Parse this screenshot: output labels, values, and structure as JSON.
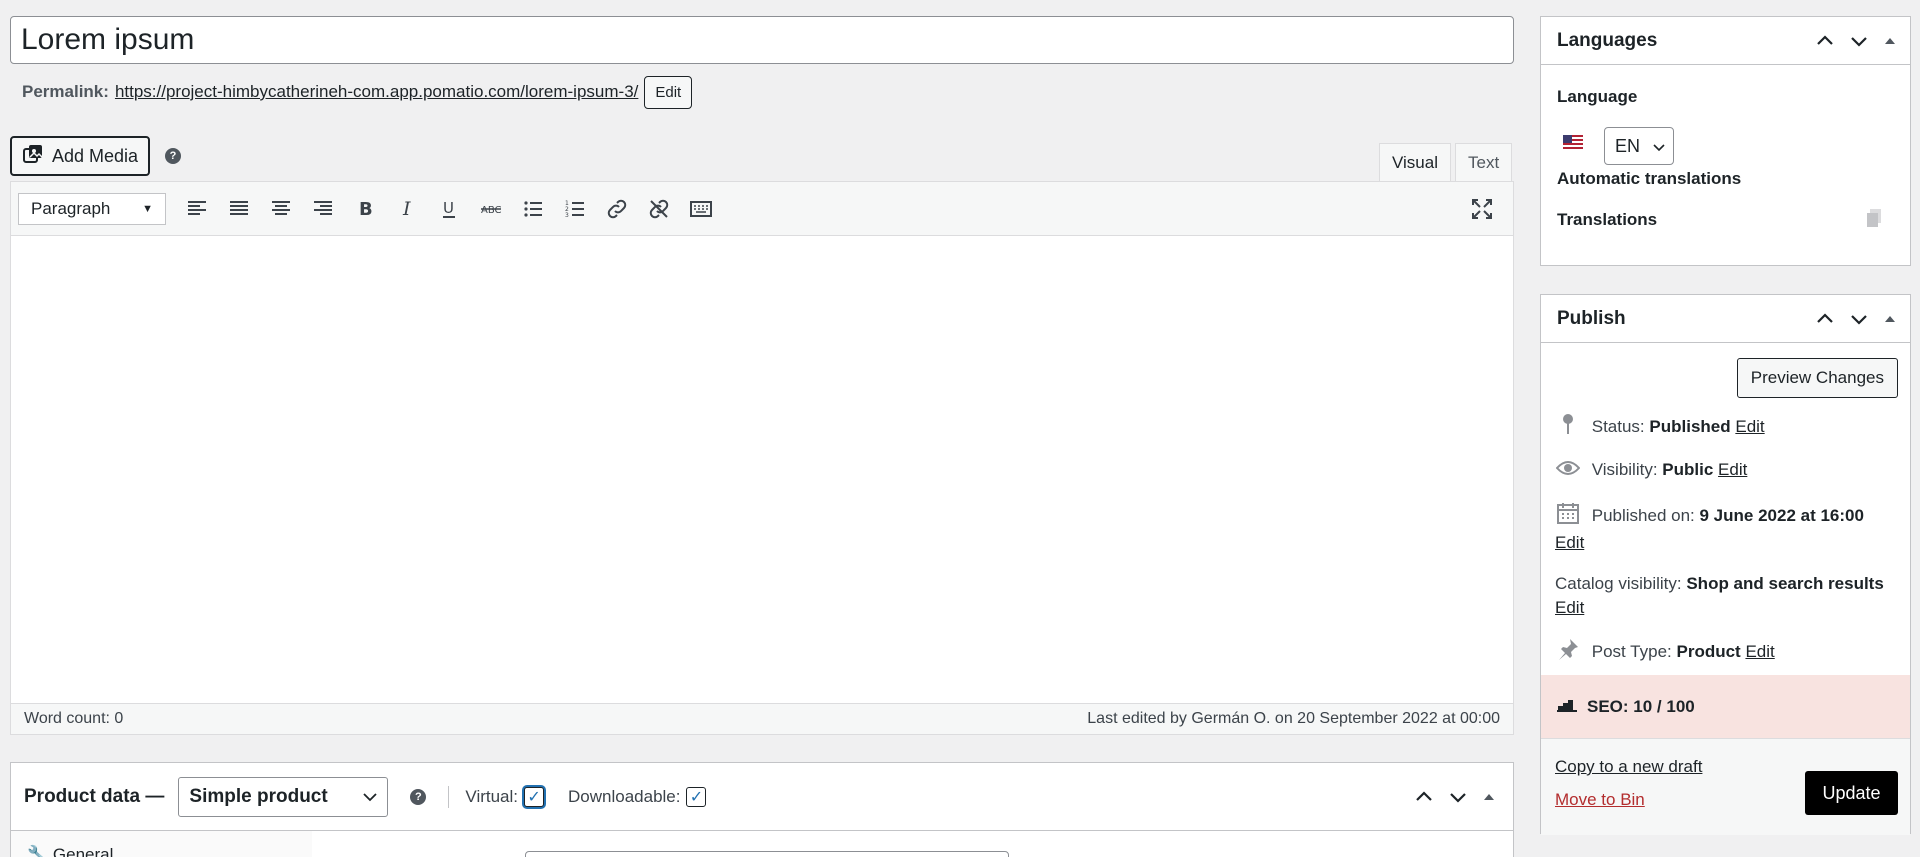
{
  "post": {
    "title": "Lorem ipsum",
    "permalink_label": "Permalink:",
    "permalink_url": "https://project-himbycatherineh-com.app.pomatio.com/lorem-ipsum-3/",
    "permalink_edit": "Edit"
  },
  "media": {
    "add_label": "Add Media",
    "help": "?"
  },
  "editor": {
    "tabs": [
      "Visual",
      "Text"
    ],
    "active_tab": "Visual",
    "format": "Paragraph",
    "word_count": "Word count: 0",
    "last_edited": "Last edited by Germán O. on 20 September 2022 at 00:00",
    "toolbar_icons": [
      "align-left-icon",
      "align-justify-icon",
      "align-center-icon",
      "align-right-icon",
      "bold-icon",
      "italic-icon",
      "underline-icon",
      "strikethrough-icon",
      "bullet-list-icon",
      "numbered-list-icon",
      "link-icon",
      "unlink-icon",
      "keyboard-icon",
      "fullscreen-icon"
    ]
  },
  "product_data": {
    "title": "Product data —",
    "type": "Simple product",
    "virtual_label": "Virtual:",
    "virtual_checked": true,
    "downloadable_label": "Downloadable:",
    "downloadable_checked": true,
    "first_tab": "General"
  },
  "languages": {
    "title": "Languages",
    "language_label": "Language",
    "language_value": "EN",
    "auto_translations": "Automatic translations",
    "translations": "Translations"
  },
  "publish": {
    "title": "Publish",
    "preview": "Preview Changes",
    "status_label": "Status:",
    "status_value": "Published",
    "visibility_label": "Visibility:",
    "visibility_value": "Public",
    "published_label": "Published on:",
    "published_value": "9 June 2022 at 16:00",
    "catalog_label": "Catalog visibility:",
    "catalog_value": "Shop and search results",
    "post_type_label": "Post Type:",
    "post_type_value": "Product",
    "edit": "Edit",
    "seo": "SEO: 10 / 100",
    "copy_draft": "Copy to a new draft",
    "move_bin": "Move to Bin",
    "update": "Update"
  },
  "colors": {
    "seo_bg": "#f8e3e0",
    "trash": "#b32d2e",
    "update_bg": "#000000",
    "checkbox": "#2271b1"
  }
}
